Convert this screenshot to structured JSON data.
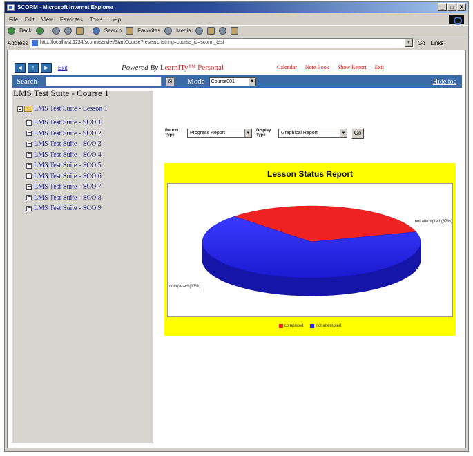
{
  "window": {
    "title": "SCORM - Microsoft Internet Explorer",
    "controls": [
      "_",
      "□",
      "X"
    ]
  },
  "menu": [
    "File",
    "Edit",
    "View",
    "Favorites",
    "Tools",
    "Help"
  ],
  "toolbar": {
    "back": "Back",
    "search": "Search",
    "favorites": "Favorites",
    "media": "Media"
  },
  "address": {
    "label": "Address",
    "url": "http://localhost:1234/scorm/servlet/StartCourse?researchstring=course_id=scorm_test",
    "go": "Go",
    "links": "Links"
  },
  "nav": {
    "prev": "◄",
    "toc": "↑",
    "next": "►",
    "exit": "Exit",
    "powered_by": "Powered By",
    "brand": "LearnITy™ Personal",
    "links": [
      "Calendar",
      "Note Book",
      "Show Report",
      "Exit"
    ]
  },
  "searchbar": {
    "search_label": "Search",
    "mode_label": "Mode",
    "mode_value": "Course001",
    "hide_toc": "Hide toc"
  },
  "toc": {
    "title": "LMS Test Suite - Course 1",
    "root": "LMS Test Suite - Lesson 1",
    "items": [
      "LMS Test Suite - SCO 1",
      "LMS Test Suite - SCO 2",
      "LMS Test Suite - SCO 3",
      "LMS Test Suite - SCO 4",
      "LMS Test Suite - SCO 5",
      "LMS Test Suite - SCO 6",
      "LMS Test Suite - SCO 7",
      "LMS Test Suite - SCO 8",
      "LMS Test Suite - SCO 9"
    ]
  },
  "controls": {
    "report_type_label": "Report Type",
    "report_type_value": "Progress Report",
    "display_type_label": "Display Type",
    "display_type_value": "Graphical Report",
    "go": "Go"
  },
  "report": {
    "title": "Lesson Status Report",
    "colors": {
      "completed": "#ee2222",
      "not_attempted": "#2222ee",
      "background": "#ffff00"
    }
  },
  "chart_data": {
    "type": "pie",
    "title": "Lesson Status Report",
    "categories": [
      "completed",
      "not attempted"
    ],
    "values": [
      33,
      67
    ],
    "labels": [
      "completed (33%)",
      "not attempted (67%)"
    ],
    "legend": "bottom"
  }
}
